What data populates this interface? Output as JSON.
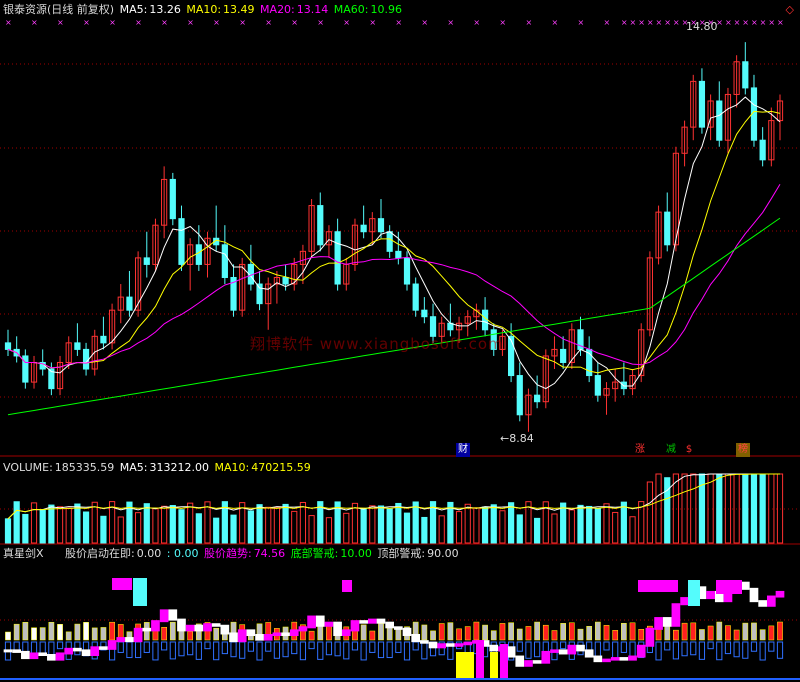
{
  "header": {
    "title": "银泰资源(日线 前复权)",
    "ma5_label": "MA5:",
    "ma5_value": "13.26",
    "ma10_label": "MA10:",
    "ma10_value": "13.49",
    "ma20_label": "MA20:",
    "ma20_value": "13.14",
    "ma60_label": "MA60:",
    "ma60_value": "10.96"
  },
  "price_panel": {
    "high_label": "14.80",
    "low_label": "8.84",
    "watermark": "翔博软件 www.xiangbosoft.com",
    "tags": [
      "财",
      "涨",
      "减",
      "$",
      "榜"
    ]
  },
  "volume_header": {
    "label": "VOLUME:",
    "value": "185335.59",
    "ma5_label": "MA5:",
    "ma5_value": "313212.00",
    "ma10_label": "MA10:",
    "ma10_value": "470215.59"
  },
  "indicator_header": {
    "name": "真星剑X",
    "start_label": "股价启动在即:",
    "start_value": "0.00",
    "extra_value": ": 0.00",
    "trend_label": "股价趋势:",
    "trend_value": "74.56",
    "bottom_label": "底部警戒:",
    "bottom_value": "10.00",
    "top_label": "顶部警戒:",
    "top_value": "90.00"
  },
  "colors": {
    "up": "#ff3232",
    "down": "#54fcfc",
    "ma5": "#ffffff",
    "ma10": "#ffff00",
    "ma20": "#ff00ff",
    "ma60": "#00ff00",
    "grid": "#a00000",
    "label": "#d0d0d0"
  },
  "chart_data": [
    {
      "type": "candlestick",
      "title": "银泰资源(日线 前复权)",
      "annotations": [
        {
          "text": "14.80",
          "kind": "high"
        },
        {
          "text": "8.84",
          "kind": "low"
        }
      ],
      "series": [
        {
          "name": "MA5",
          "last": 13.26
        },
        {
          "name": "MA10",
          "last": 13.49
        },
        {
          "name": "MA20",
          "last": 13.14
        },
        {
          "name": "MA60",
          "last": 10.96
        }
      ],
      "ylim": [
        8.5,
        15.2
      ],
      "bars": [
        [
          10.2,
          10.4,
          10.0,
          10.1
        ],
        [
          10.1,
          10.3,
          9.9,
          10.0
        ],
        [
          10.0,
          10.1,
          9.5,
          9.6
        ],
        [
          9.6,
          10.0,
          9.5,
          9.9
        ],
        [
          9.9,
          10.1,
          9.7,
          9.8
        ],
        [
          9.8,
          9.9,
          9.4,
          9.5
        ],
        [
          9.5,
          10.0,
          9.4,
          9.9
        ],
        [
          9.9,
          10.3,
          9.8,
          10.2
        ],
        [
          10.2,
          10.5,
          10.0,
          10.1
        ],
        [
          10.1,
          10.2,
          9.7,
          9.8
        ],
        [
          9.8,
          10.4,
          9.7,
          10.3
        ],
        [
          10.3,
          10.6,
          10.1,
          10.2
        ],
        [
          10.2,
          10.8,
          10.1,
          10.7
        ],
        [
          10.7,
          11.1,
          10.5,
          10.9
        ],
        [
          10.9,
          11.3,
          10.6,
          10.7
        ],
        [
          10.7,
          11.6,
          10.6,
          11.5
        ],
        [
          11.5,
          11.9,
          11.2,
          11.4
        ],
        [
          11.4,
          12.1,
          11.3,
          12.0
        ],
        [
          12.0,
          12.9,
          11.8,
          12.7
        ],
        [
          12.7,
          12.8,
          12.0,
          12.1
        ],
        [
          12.1,
          12.3,
          11.3,
          11.4
        ],
        [
          11.4,
          11.8,
          11.0,
          11.7
        ],
        [
          11.7,
          12.0,
          11.3,
          11.4
        ],
        [
          11.4,
          11.9,
          11.2,
          11.8
        ],
        [
          11.8,
          12.3,
          11.6,
          11.7
        ],
        [
          11.7,
          12.0,
          11.1,
          11.2
        ],
        [
          11.2,
          11.4,
          10.6,
          10.7
        ],
        [
          10.7,
          11.5,
          10.6,
          11.4
        ],
        [
          11.4,
          11.7,
          11.0,
          11.1
        ],
        [
          11.1,
          11.3,
          10.7,
          10.8
        ],
        [
          10.8,
          11.2,
          10.4,
          11.1
        ],
        [
          11.1,
          11.3,
          10.8,
          11.2
        ],
        [
          11.2,
          11.4,
          11.0,
          11.1
        ],
        [
          11.1,
          11.5,
          11.0,
          11.4
        ],
        [
          11.4,
          11.7,
          11.1,
          11.6
        ],
        [
          11.6,
          12.4,
          11.5,
          12.3
        ],
        [
          12.3,
          12.5,
          11.6,
          11.7
        ],
        [
          11.7,
          12.0,
          11.5,
          11.9
        ],
        [
          11.9,
          12.1,
          11.0,
          11.1
        ],
        [
          11.1,
          11.5,
          11.0,
          11.4
        ],
        [
          11.4,
          12.1,
          11.3,
          12.0
        ],
        [
          12.0,
          12.3,
          11.8,
          11.9
        ],
        [
          11.9,
          12.2,
          11.7,
          12.1
        ],
        [
          12.1,
          12.4,
          11.8,
          11.9
        ],
        [
          11.9,
          12.0,
          11.5,
          11.6
        ],
        [
          11.6,
          11.9,
          11.4,
          11.5
        ],
        [
          11.5,
          11.6,
          11.0,
          11.1
        ],
        [
          11.1,
          11.2,
          10.6,
          10.7
        ],
        [
          10.7,
          10.9,
          10.5,
          10.6
        ],
        [
          10.6,
          10.8,
          10.2,
          10.3
        ],
        [
          10.3,
          10.6,
          10.2,
          10.5
        ],
        [
          10.5,
          10.8,
          10.3,
          10.4
        ],
        [
          10.4,
          10.6,
          10.2,
          10.5
        ],
        [
          10.5,
          10.7,
          10.3,
          10.6
        ],
        [
          10.6,
          10.8,
          10.4,
          10.7
        ],
        [
          10.7,
          10.9,
          10.3,
          10.4
        ],
        [
          10.4,
          10.5,
          10.0,
          10.1
        ],
        [
          10.1,
          10.4,
          10.0,
          10.3
        ],
        [
          10.3,
          10.5,
          9.6,
          9.7
        ],
        [
          9.7,
          9.9,
          9.0,
          9.1
        ],
        [
          9.1,
          9.5,
          8.84,
          9.4
        ],
        [
          9.4,
          9.7,
          9.2,
          9.3
        ],
        [
          9.3,
          10.1,
          9.2,
          10.0
        ],
        [
          10.0,
          10.3,
          9.8,
          10.1
        ],
        [
          10.1,
          10.3,
          9.8,
          9.9
        ],
        [
          9.9,
          10.5,
          9.8,
          10.4
        ],
        [
          10.4,
          10.6,
          10.0,
          10.1
        ],
        [
          10.1,
          10.3,
          9.6,
          9.7
        ],
        [
          9.7,
          9.9,
          9.3,
          9.4
        ],
        [
          9.4,
          9.6,
          9.1,
          9.5
        ],
        [
          9.5,
          9.8,
          9.3,
          9.6
        ],
        [
          9.6,
          9.9,
          9.4,
          9.5
        ],
        [
          9.5,
          9.8,
          9.4,
          9.7
        ],
        [
          9.7,
          10.5,
          9.6,
          10.4
        ],
        [
          10.4,
          11.6,
          10.3,
          11.5
        ],
        [
          11.5,
          12.3,
          11.4,
          12.2
        ],
        [
          12.2,
          12.5,
          11.6,
          11.7
        ],
        [
          11.7,
          13.2,
          11.6,
          13.1
        ],
        [
          13.1,
          13.6,
          12.9,
          13.5
        ],
        [
          13.5,
          14.3,
          13.3,
          14.2
        ],
        [
          14.2,
          14.4,
          13.4,
          13.5
        ],
        [
          13.5,
          14.0,
          13.3,
          13.9
        ],
        [
          13.9,
          14.2,
          13.2,
          13.3
        ],
        [
          13.3,
          14.1,
          13.1,
          14.0
        ],
        [
          14.0,
          14.6,
          13.8,
          14.5
        ],
        [
          14.5,
          14.8,
          14.0,
          14.1
        ],
        [
          14.1,
          14.3,
          13.2,
          13.3
        ],
        [
          13.3,
          13.5,
          12.9,
          13.0
        ],
        [
          13.0,
          13.8,
          12.9,
          13.6
        ],
        [
          13.6,
          14.0,
          13.3,
          13.9
        ]
      ]
    },
    {
      "type": "bar",
      "title": "VOLUME",
      "series": [
        {
          "name": "VOLUME",
          "last": 185335.59
        },
        {
          "name": "MA5",
          "last": 313212.0
        },
        {
          "name": "MA10",
          "last": 470215.59
        }
      ]
    },
    {
      "type": "line",
      "title": "真星剑X",
      "series": [
        {
          "name": "股价启动在即",
          "last": 0.0
        },
        {
          "name": "股价趋势",
          "last": 74.56
        },
        {
          "name": "底部警戒",
          "last": 10.0
        },
        {
          "name": "顶部警戒",
          "last": 90.0
        }
      ]
    }
  ]
}
